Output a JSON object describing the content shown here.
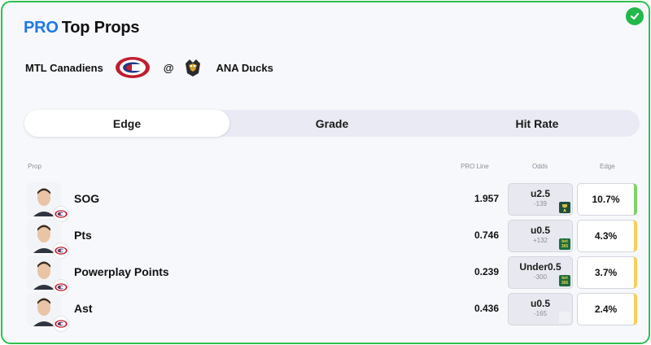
{
  "header": {
    "brand": "PRO",
    "title": "Top Props"
  },
  "matchup": {
    "home_team": "MTL Canadiens",
    "separator": "@",
    "away_team": "ANA Ducks"
  },
  "tabs": [
    {
      "label": "Edge",
      "active": true
    },
    {
      "label": "Grade",
      "active": false
    },
    {
      "label": "Hit Rate",
      "active": false
    }
  ],
  "columns": {
    "prop": "Prop",
    "pro_line": "PRO Line",
    "odds": "Odds",
    "edge": "Edge"
  },
  "rows": [
    {
      "prop": "SOG",
      "pro_line": "1.957",
      "odds_line": "u2.5",
      "odds_price": "-139",
      "book_icon": "sportsbook-trophy-icon",
      "edge": "10.7%",
      "edge_color": "#7dd36a"
    },
    {
      "prop": "Pts",
      "pro_line": "0.746",
      "odds_line": "u0.5",
      "odds_price": "+132",
      "book_icon": "bet365-icon",
      "book_label": "bet 365",
      "edge": "4.3%",
      "edge_color": "#f5cf5a"
    },
    {
      "prop": "Powerplay Points",
      "pro_line": "0.239",
      "odds_line": "Under0.5",
      "odds_price": "-300",
      "book_icon": "bet365-icon",
      "book_label": "bet 365",
      "edge": "3.7%",
      "edge_color": "#f5cf5a"
    },
    {
      "prop": "Ast",
      "pro_line": "0.436",
      "odds_line": "u0.5",
      "odds_price": "-165",
      "book_icon": "sportsbook-faint-icon",
      "edge": "2.4%",
      "edge_color": "#f5cf5a"
    }
  ],
  "colors": {
    "brand": "#1e78e6",
    "card_border": "#2fbf4e",
    "check": "#20b94a"
  }
}
